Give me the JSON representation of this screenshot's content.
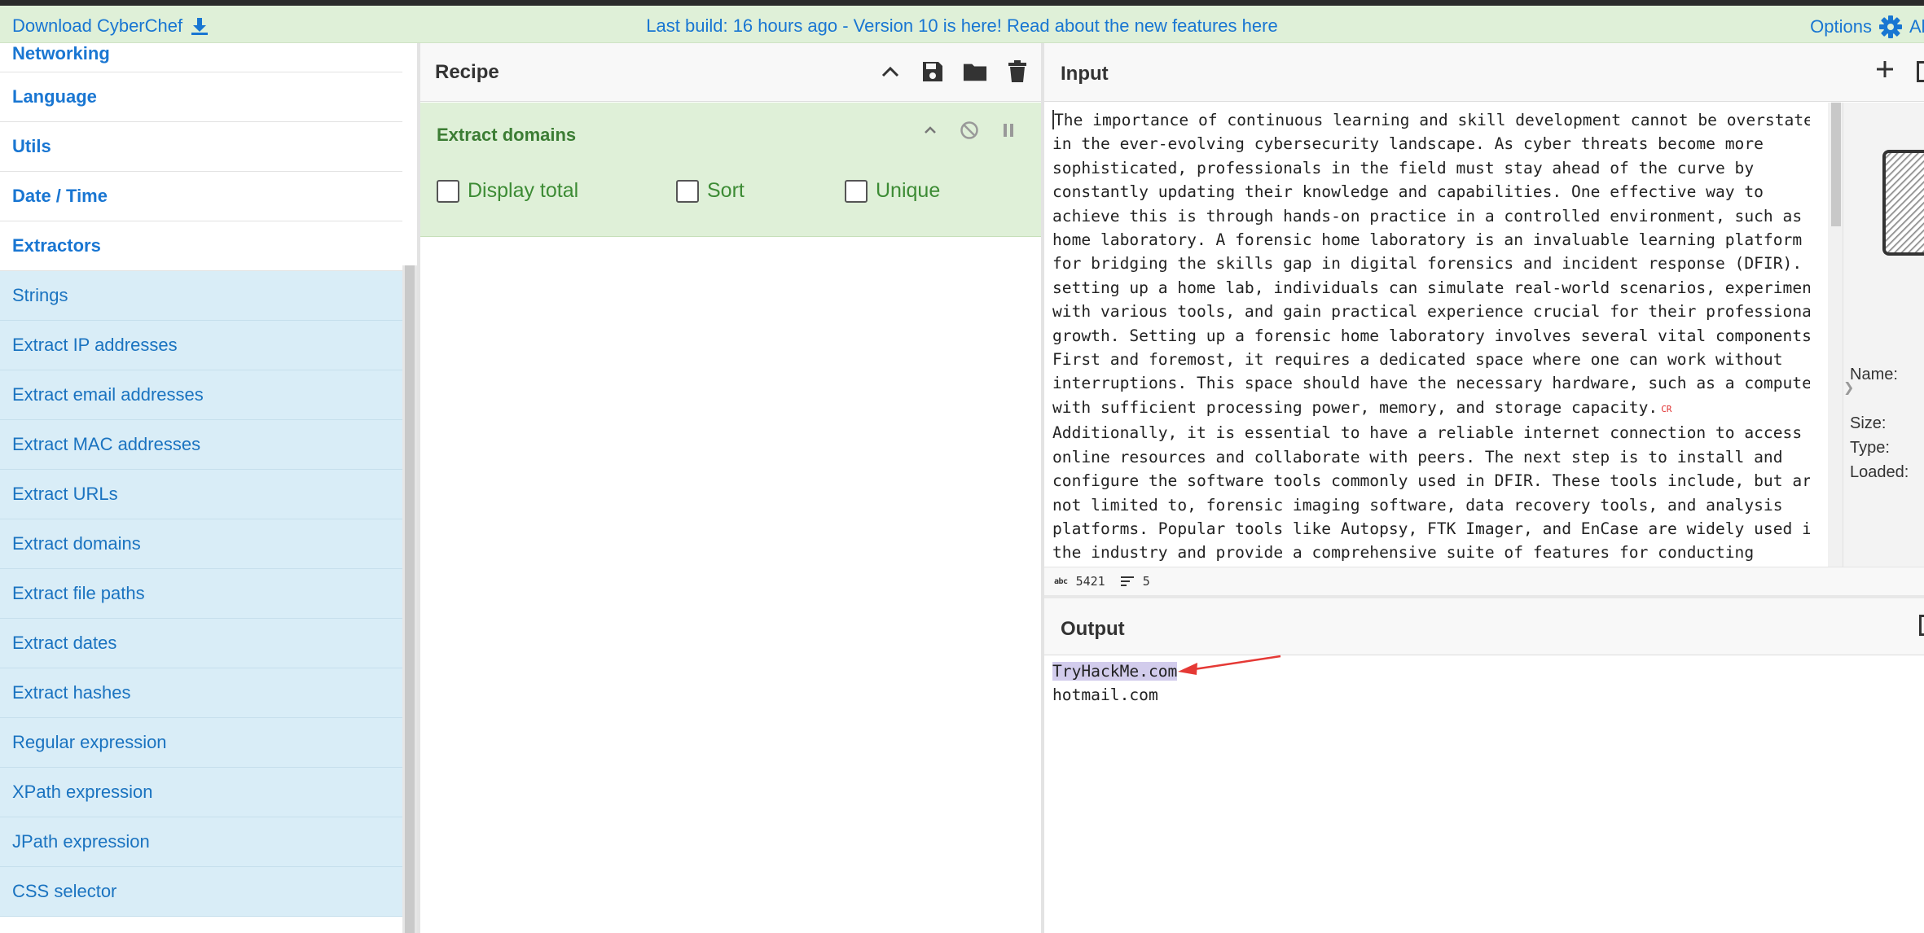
{
  "banner": {
    "download_label": "Download CyberChef",
    "notice": "Last build: 16 hours ago - Version 10 is here! Read about the new features here",
    "options_label": "Options",
    "about_label": "About / Support"
  },
  "sidebar": {
    "categories": [
      "Networking",
      "Language",
      "Utils",
      "Date / Time",
      "Extractors"
    ],
    "operations": [
      "Strings",
      "Extract IP addresses",
      "Extract email addresses",
      "Extract MAC addresses",
      "Extract URLs",
      "Extract domains",
      "Extract file paths",
      "Extract dates",
      "Extract hashes",
      "Regular expression",
      "XPath expression",
      "JPath expression",
      "CSS selector"
    ]
  },
  "recipe": {
    "title": "Recipe",
    "operation": {
      "name": "Extract domains",
      "options": [
        {
          "label": "Display total",
          "checked": false
        },
        {
          "label": "Sort",
          "checked": false
        },
        {
          "label": "Unique",
          "checked": false
        }
      ]
    }
  },
  "input": {
    "title": "Input",
    "lines": [
      "The importance of continuous learning and skill development cannot be overstated",
      "in the ever-evolving cybersecurity landscape. As cyber threats become more",
      "sophisticated, professionals in the field must stay ahead of the curve by",
      "constantly updating their knowledge and capabilities. One effective way to",
      "achieve this is through hands-on practice in a controlled environment, such as a",
      "home laboratory. A forensic home laboratory is an invaluable learning platform",
      "for bridging the skills gap in digital forensics and incident response (DFIR). By",
      "setting up a home lab, individuals can simulate real-world scenarios, experiment",
      "with various tools, and gain practical experience crucial for their professional",
      "growth. Setting up a forensic home laboratory involves several vital components.",
      "First and foremost, it requires a dedicated space where one can work without",
      "interruptions. This space should have the necessary hardware, such as a computer",
      "with sufficient processing power, memory, and storage capacity.",
      "Additionally, it is essential to have a reliable internet connection to access",
      "online resources and collaborate with peers. The next step is to install and",
      "configure the software tools commonly used in DFIR. These tools include, but are",
      "not limited to, forensic imaging software, data recovery tools, and analysis",
      "platforms. Popular tools like Autopsy, FTK Imager, and EnCase are widely used in",
      "the industry and provide a comprehensive suite of features for conducting"
    ],
    "cr_marker": "CR",
    "file": {
      "name_label": "Name:",
      "size_label": "Size:",
      "type_label": "Type:",
      "loaded_label": "Loaded:"
    },
    "status": {
      "abc_icon": "abc",
      "length": "5421",
      "lines": "5"
    }
  },
  "output": {
    "title": "Output",
    "lines": [
      "TryHackMe.com",
      "hotmail.com"
    ],
    "highlight_color": "#d2ccec",
    "annotation_color": "#e53935"
  }
}
